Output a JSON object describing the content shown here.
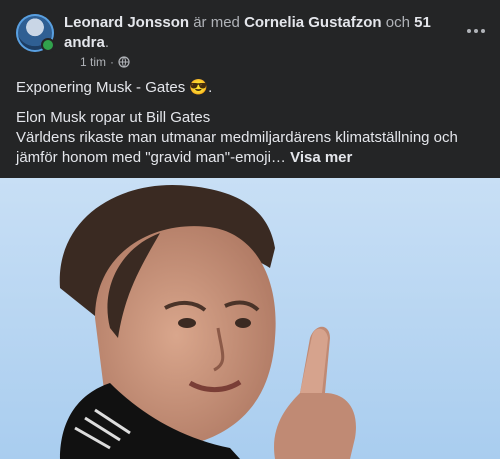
{
  "post": {
    "author": "Leonard Jonsson",
    "with_text": "är med",
    "tagged_person": "Cornelia Gustafzon",
    "and_text": "och",
    "others": "51 andra",
    "period": ".",
    "time": "1 tim",
    "separator": "·",
    "privacy_icon": "globe-icon",
    "status_text": "Exponering Musk - Gates",
    "status_emoji": "😎",
    "status_end": ".",
    "headline": "Elon Musk ropar ut Bill Gates",
    "description": "Världens rikaste man utmanar medmiljardärens klimatställning och jämför honom med \"gravid man\"-emoji…",
    "see_more": "Visa mer"
  },
  "colors": {
    "background": "#242526",
    "text_primary": "#e4e6eb",
    "text_secondary": "#b0b3b8",
    "online": "#31a24c"
  }
}
